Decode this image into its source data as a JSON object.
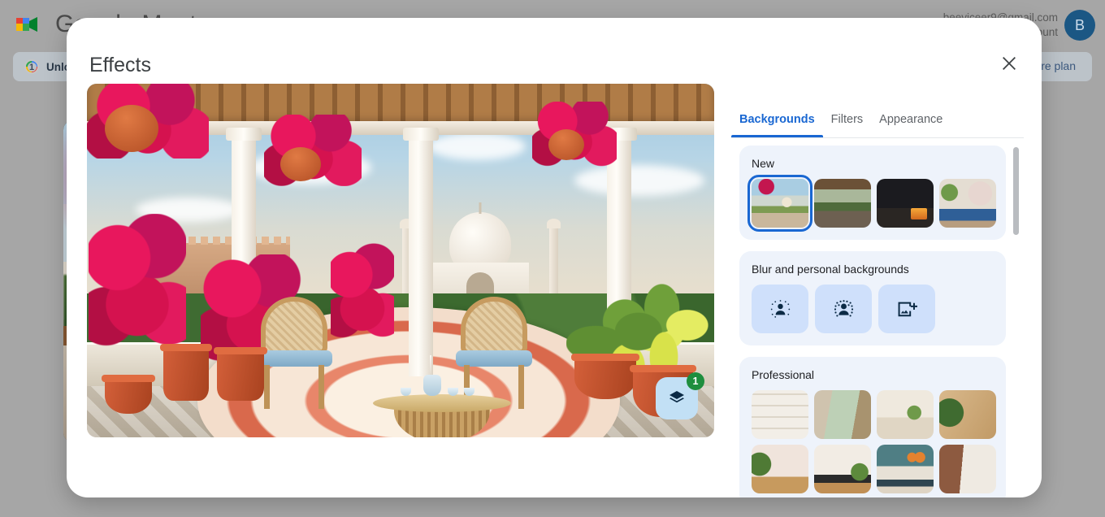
{
  "app": {
    "brand": "Google Meet",
    "wordmark": "Google Meet",
    "logo_icon": "google-meet-video-icon",
    "account_email": "beeviceer9@gmail.com",
    "account_line2": "Switch account",
    "avatar_initial": "B",
    "banner": {
      "icon": "info-circle-one-icon",
      "text": "Unlock premium features",
      "cta": "Explore plan"
    }
  },
  "dialog": {
    "title": "Effects",
    "close_icon": "close-icon",
    "tabs": [
      {
        "label": "Backgrounds",
        "active": true
      },
      {
        "label": "Filters",
        "active": false
      },
      {
        "label": "Appearance",
        "active": false
      }
    ],
    "preview": {
      "description": "Taj Mahal balcony background preview",
      "layers_button_icon": "layers-icon",
      "layers_badge": "1"
    },
    "groups": [
      {
        "title": "New",
        "kind": "thumbs",
        "items": [
          {
            "name": "taj-mahal-balcony",
            "art": "t-taj",
            "selected": true
          },
          {
            "name": "pergola-terrace",
            "art": "t-pergola",
            "selected": false
          },
          {
            "name": "dark-room-fireplace",
            "art": "t-fire",
            "selected": false
          },
          {
            "name": "gallery-wall-sofa",
            "art": "t-gallery",
            "selected": false
          }
        ]
      },
      {
        "title": "Blur and personal backgrounds",
        "kind": "blur",
        "items": [
          {
            "name": "slight-blur",
            "icon": "slight-blur-icon"
          },
          {
            "name": "blur-background",
            "icon": "heavy-blur-icon"
          },
          {
            "name": "add-background-image",
            "icon": "add-image-icon"
          }
        ]
      },
      {
        "title": "Professional",
        "kind": "thumbs",
        "items": [
          {
            "name": "white-bookshelf",
            "art": "t-shelf",
            "selected": false
          },
          {
            "name": "green-bedroom",
            "art": "t-green",
            "selected": false
          },
          {
            "name": "shelf-and-sofa",
            "art": "t-sofa",
            "selected": false
          },
          {
            "name": "wood-wall-plant",
            "art": "t-wood",
            "selected": false
          },
          {
            "name": "framed-art-kitchen",
            "art": "t-frames",
            "selected": false
          },
          {
            "name": "minimal-desk",
            "art": "t-desk",
            "selected": false
          },
          {
            "name": "loft-pendant-lights",
            "art": "t-loft",
            "selected": false
          },
          {
            "name": "brick-dining-room",
            "art": "t-brick",
            "selected": false
          }
        ]
      }
    ]
  },
  "colors": {
    "accent": "#1967d2",
    "badge_green": "#1e8e3e",
    "group_bg": "#eef3fb",
    "blur_tile": "#cfe0fb",
    "fab": "#c2e0f5",
    "scrim": "#a9a9a9"
  }
}
